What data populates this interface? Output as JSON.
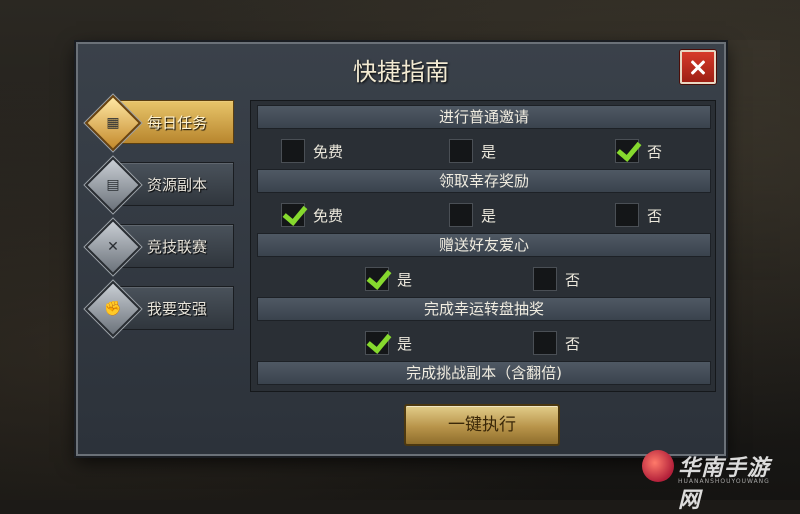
{
  "dialog": {
    "title": "快捷指南"
  },
  "sidebar": {
    "items": [
      {
        "label": "每日任务",
        "icon": "calendar-icon",
        "active": true
      },
      {
        "label": "资源副本",
        "icon": "scroll-icon",
        "active": false
      },
      {
        "label": "竞技联赛",
        "icon": "crossed-swords-icon",
        "active": false
      },
      {
        "label": "我要变强",
        "icon": "muscle-arm-icon",
        "active": false
      }
    ]
  },
  "sections": [
    {
      "title": "进行普通邀请",
      "options": [
        {
          "label": "免费",
          "checked": false
        },
        {
          "label": "是",
          "checked": false
        },
        {
          "label": "否",
          "checked": true
        }
      ]
    },
    {
      "title": "领取幸存奖励",
      "options": [
        {
          "label": "免费",
          "checked": true
        },
        {
          "label": "是",
          "checked": false
        },
        {
          "label": "否",
          "checked": false
        }
      ]
    },
    {
      "title": "赠送好友爱心",
      "options": [
        {
          "label": "是",
          "checked": true
        },
        {
          "label": "否",
          "checked": false
        }
      ]
    },
    {
      "title": "完成幸运转盘抽奖",
      "options": [
        {
          "label": "是",
          "checked": true
        },
        {
          "label": "否",
          "checked": false
        }
      ]
    },
    {
      "title": "完成挑战副本（含翻倍)",
      "options": []
    }
  ],
  "execute_button": "一键执行",
  "watermark": {
    "text": "华南手游网",
    "sub": "HUANANSHOUYOUWANG"
  },
  "colors": {
    "accent_gold": "#b8862e",
    "check_green": "#86d92e",
    "close_red": "#c42e20"
  }
}
